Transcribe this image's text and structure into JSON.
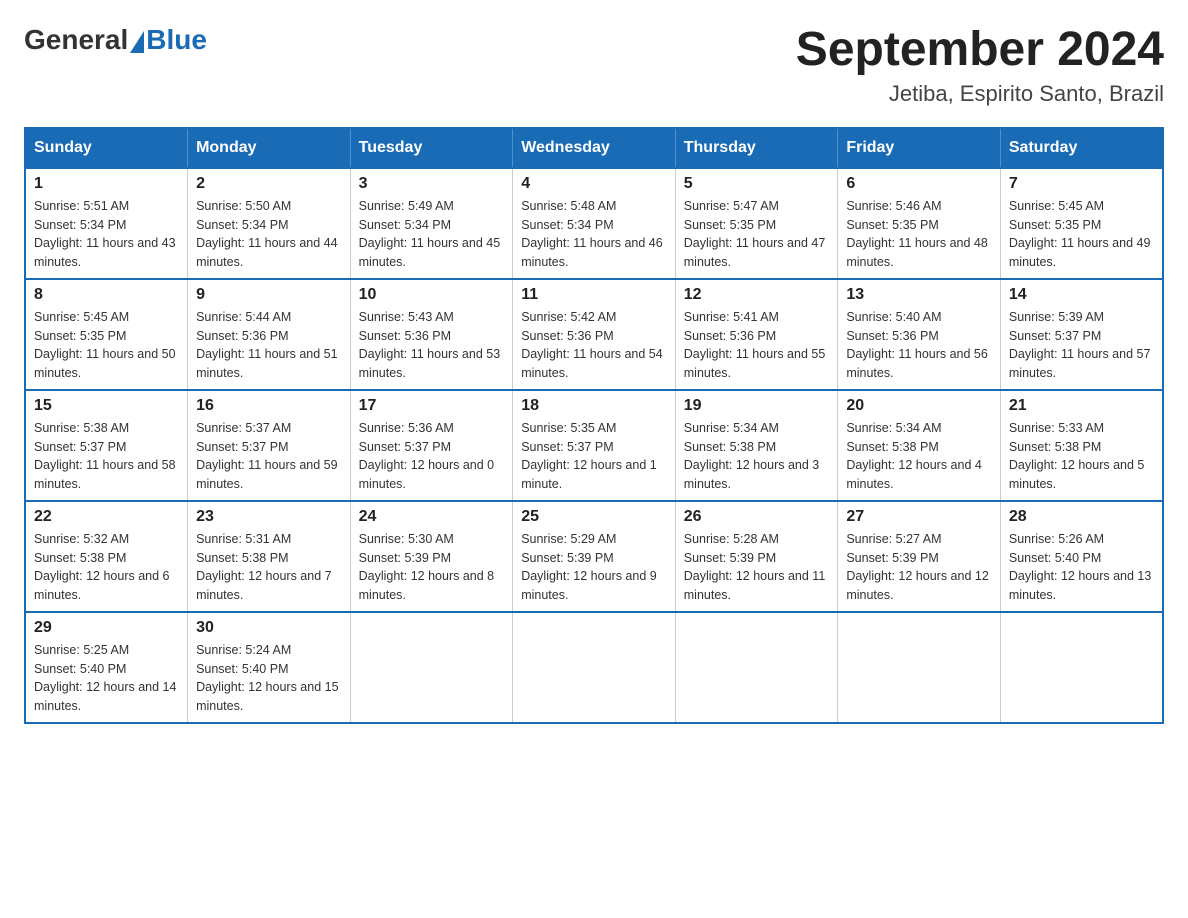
{
  "header": {
    "logo_general": "General",
    "logo_blue": "Blue",
    "month_title": "September 2024",
    "location": "Jetiba, Espirito Santo, Brazil"
  },
  "days_of_week": [
    "Sunday",
    "Monday",
    "Tuesday",
    "Wednesday",
    "Thursday",
    "Friday",
    "Saturday"
  ],
  "weeks": [
    [
      {
        "day": "1",
        "sunrise": "5:51 AM",
        "sunset": "5:34 PM",
        "daylight": "11 hours and 43 minutes."
      },
      {
        "day": "2",
        "sunrise": "5:50 AM",
        "sunset": "5:34 PM",
        "daylight": "11 hours and 44 minutes."
      },
      {
        "day": "3",
        "sunrise": "5:49 AM",
        "sunset": "5:34 PM",
        "daylight": "11 hours and 45 minutes."
      },
      {
        "day": "4",
        "sunrise": "5:48 AM",
        "sunset": "5:34 PM",
        "daylight": "11 hours and 46 minutes."
      },
      {
        "day": "5",
        "sunrise": "5:47 AM",
        "sunset": "5:35 PM",
        "daylight": "11 hours and 47 minutes."
      },
      {
        "day": "6",
        "sunrise": "5:46 AM",
        "sunset": "5:35 PM",
        "daylight": "11 hours and 48 minutes."
      },
      {
        "day": "7",
        "sunrise": "5:45 AM",
        "sunset": "5:35 PM",
        "daylight": "11 hours and 49 minutes."
      }
    ],
    [
      {
        "day": "8",
        "sunrise": "5:45 AM",
        "sunset": "5:35 PM",
        "daylight": "11 hours and 50 minutes."
      },
      {
        "day": "9",
        "sunrise": "5:44 AM",
        "sunset": "5:36 PM",
        "daylight": "11 hours and 51 minutes."
      },
      {
        "day": "10",
        "sunrise": "5:43 AM",
        "sunset": "5:36 PM",
        "daylight": "11 hours and 53 minutes."
      },
      {
        "day": "11",
        "sunrise": "5:42 AM",
        "sunset": "5:36 PM",
        "daylight": "11 hours and 54 minutes."
      },
      {
        "day": "12",
        "sunrise": "5:41 AM",
        "sunset": "5:36 PM",
        "daylight": "11 hours and 55 minutes."
      },
      {
        "day": "13",
        "sunrise": "5:40 AM",
        "sunset": "5:36 PM",
        "daylight": "11 hours and 56 minutes."
      },
      {
        "day": "14",
        "sunrise": "5:39 AM",
        "sunset": "5:37 PM",
        "daylight": "11 hours and 57 minutes."
      }
    ],
    [
      {
        "day": "15",
        "sunrise": "5:38 AM",
        "sunset": "5:37 PM",
        "daylight": "11 hours and 58 minutes."
      },
      {
        "day": "16",
        "sunrise": "5:37 AM",
        "sunset": "5:37 PM",
        "daylight": "11 hours and 59 minutes."
      },
      {
        "day": "17",
        "sunrise": "5:36 AM",
        "sunset": "5:37 PM",
        "daylight": "12 hours and 0 minutes."
      },
      {
        "day": "18",
        "sunrise": "5:35 AM",
        "sunset": "5:37 PM",
        "daylight": "12 hours and 1 minute."
      },
      {
        "day": "19",
        "sunrise": "5:34 AM",
        "sunset": "5:38 PM",
        "daylight": "12 hours and 3 minutes."
      },
      {
        "day": "20",
        "sunrise": "5:34 AM",
        "sunset": "5:38 PM",
        "daylight": "12 hours and 4 minutes."
      },
      {
        "day": "21",
        "sunrise": "5:33 AM",
        "sunset": "5:38 PM",
        "daylight": "12 hours and 5 minutes."
      }
    ],
    [
      {
        "day": "22",
        "sunrise": "5:32 AM",
        "sunset": "5:38 PM",
        "daylight": "12 hours and 6 minutes."
      },
      {
        "day": "23",
        "sunrise": "5:31 AM",
        "sunset": "5:38 PM",
        "daylight": "12 hours and 7 minutes."
      },
      {
        "day": "24",
        "sunrise": "5:30 AM",
        "sunset": "5:39 PM",
        "daylight": "12 hours and 8 minutes."
      },
      {
        "day": "25",
        "sunrise": "5:29 AM",
        "sunset": "5:39 PM",
        "daylight": "12 hours and 9 minutes."
      },
      {
        "day": "26",
        "sunrise": "5:28 AM",
        "sunset": "5:39 PM",
        "daylight": "12 hours and 11 minutes."
      },
      {
        "day": "27",
        "sunrise": "5:27 AM",
        "sunset": "5:39 PM",
        "daylight": "12 hours and 12 minutes."
      },
      {
        "day": "28",
        "sunrise": "5:26 AM",
        "sunset": "5:40 PM",
        "daylight": "12 hours and 13 minutes."
      }
    ],
    [
      {
        "day": "29",
        "sunrise": "5:25 AM",
        "sunset": "5:40 PM",
        "daylight": "12 hours and 14 minutes."
      },
      {
        "day": "30",
        "sunrise": "5:24 AM",
        "sunset": "5:40 PM",
        "daylight": "12 hours and 15 minutes."
      },
      null,
      null,
      null,
      null,
      null
    ]
  ]
}
